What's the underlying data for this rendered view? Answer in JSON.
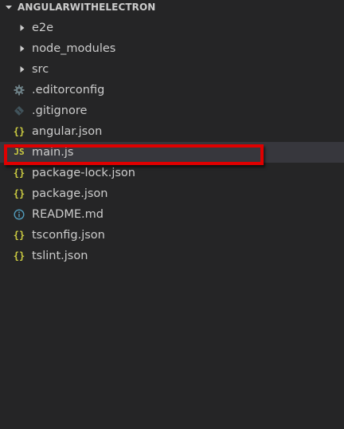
{
  "explorer": {
    "section_title": "ANGULARWITHELECTRON",
    "items": [
      {
        "label": "e2e",
        "kind": "folder",
        "icon": "chevron-right-icon"
      },
      {
        "label": "node_modules",
        "kind": "folder",
        "icon": "chevron-right-icon"
      },
      {
        "label": "src",
        "kind": "folder",
        "icon": "chevron-right-icon"
      },
      {
        "label": ".editorconfig",
        "kind": "file",
        "icon": "gear-icon",
        "glyph": "⚙",
        "color": "#6d8086"
      },
      {
        "label": ".gitignore",
        "kind": "file",
        "icon": "git-icon",
        "glyph": "◈",
        "color": "#41535b"
      },
      {
        "label": "angular.json",
        "kind": "file",
        "icon": "json-braces-icon",
        "glyph": "{}",
        "color": "#cbcb41"
      },
      {
        "label": "main.js",
        "kind": "file",
        "icon": "js-icon",
        "glyph": "JS",
        "color": "#cbcb41",
        "selected": true
      },
      {
        "label": "package-lock.json",
        "kind": "file",
        "icon": "json-braces-icon",
        "glyph": "{}",
        "color": "#cbcb41"
      },
      {
        "label": "package.json",
        "kind": "file",
        "icon": "json-braces-icon",
        "glyph": "{}",
        "color": "#cbcb41"
      },
      {
        "label": "README.md",
        "kind": "file",
        "icon": "info-icon",
        "glyph": "ⓘ",
        "color": "#519aba"
      },
      {
        "label": "tsconfig.json",
        "kind": "file",
        "icon": "json-braces-icon",
        "glyph": "{}",
        "color": "#cbcb41"
      },
      {
        "label": "tslint.json",
        "kind": "file",
        "icon": "json-braces-icon",
        "glyph": "{}",
        "color": "#cbcb41"
      }
    ]
  },
  "colors": {
    "background": "#252526",
    "text": "#cccccc",
    "selection": "#37373d",
    "highlight_border": "#e00000"
  }
}
